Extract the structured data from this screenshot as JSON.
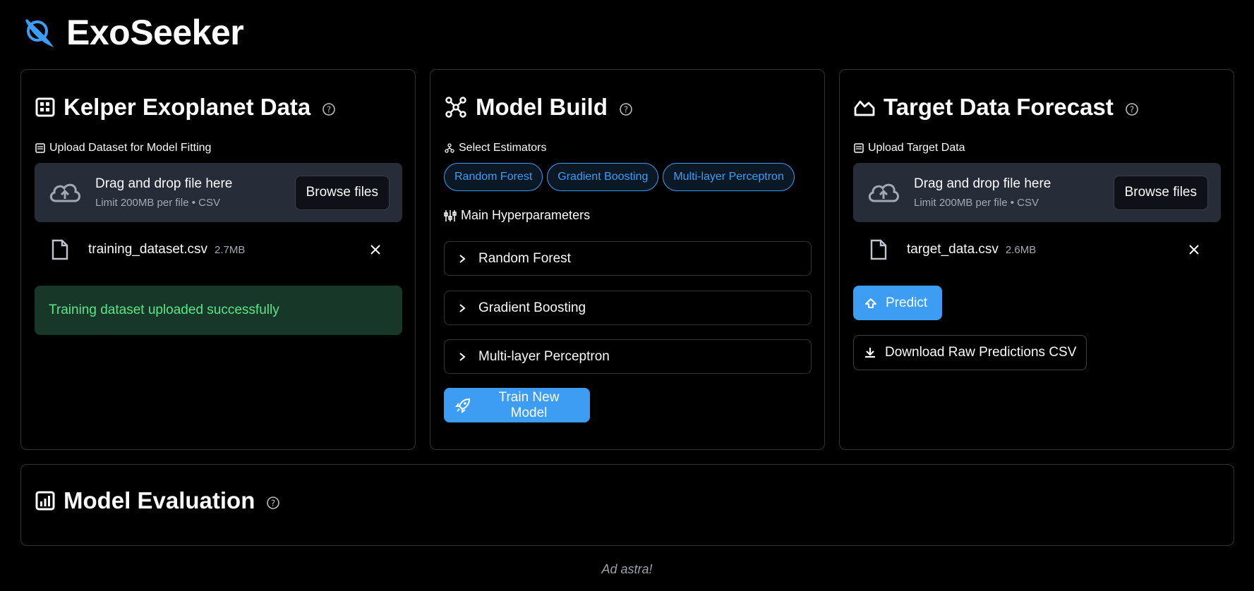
{
  "app": {
    "title": "ExoSeeker"
  },
  "colors": {
    "accent": "#3d9df3",
    "success_bg": "#173828",
    "success_text": "#5ce488",
    "uploader_bg": "#262d38"
  },
  "data_card": {
    "title": "Kelper Exoplanet Data",
    "upload_label": "Upload Dataset for Model Fitting",
    "dropzone_title": "Drag and drop file here",
    "dropzone_sub": "Limit 200MB per file • CSV",
    "browse_label": "Browse files",
    "file_name": "training_dataset.csv",
    "file_size": "2.7MB",
    "success_message": "Training dataset uploaded successfully"
  },
  "model_card": {
    "title": "Model Build",
    "estimators_label": "Select Estimators",
    "estimators": [
      "Random Forest",
      "Gradient Boosting",
      "Multi-layer Perceptron"
    ],
    "hyper_label": "Main Hyperparameters",
    "expanders": [
      "Random Forest",
      "Gradient Boosting",
      "Multi-layer Perceptron"
    ],
    "train_label": "Train New Model"
  },
  "target_card": {
    "title": "Target Data Forecast",
    "upload_label": "Upload Target Data",
    "dropzone_title": "Drag and drop file here",
    "dropzone_sub": "Limit 200MB per file • CSV",
    "browse_label": "Browse files",
    "file_name": "target_data.csv",
    "file_size": "2.6MB",
    "predict_label": "Predict",
    "download_label": "Download Raw Predictions CSV"
  },
  "eval_card": {
    "title": "Model Evaluation"
  },
  "footer": {
    "text": "Ad astra!"
  }
}
